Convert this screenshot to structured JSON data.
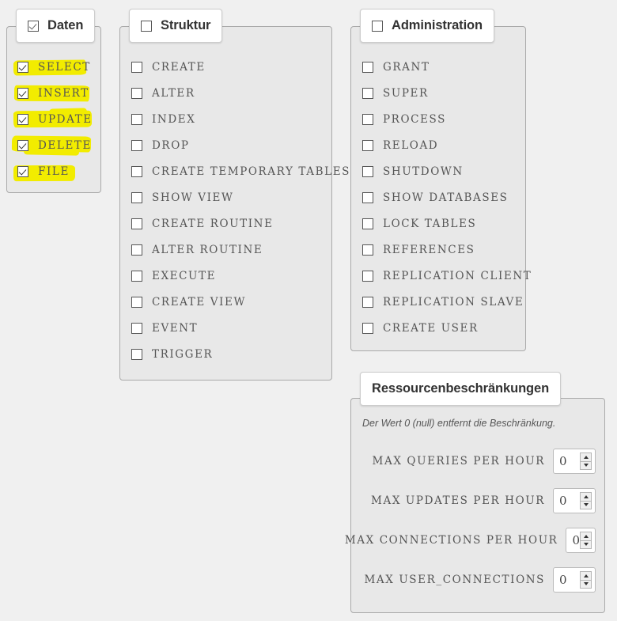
{
  "groups": {
    "daten": {
      "title": "Daten",
      "legend_checked": true,
      "items": [
        {
          "label": "SELECT",
          "checked": true,
          "highlighted": true
        },
        {
          "label": "INSERT",
          "checked": true,
          "highlighted": true
        },
        {
          "label": "UPDATE",
          "checked": true,
          "highlighted": true
        },
        {
          "label": "DELETE",
          "checked": true,
          "highlighted": true
        },
        {
          "label": "FILE",
          "checked": true,
          "highlighted": true
        }
      ]
    },
    "struktur": {
      "title": "Struktur",
      "legend_checked": false,
      "items": [
        {
          "label": "CREATE",
          "checked": false
        },
        {
          "label": "ALTER",
          "checked": false
        },
        {
          "label": "INDEX",
          "checked": false
        },
        {
          "label": "DROP",
          "checked": false
        },
        {
          "label": "CREATE TEMPORARY TABLES",
          "checked": false
        },
        {
          "label": "SHOW VIEW",
          "checked": false
        },
        {
          "label": "CREATE ROUTINE",
          "checked": false
        },
        {
          "label": "ALTER ROUTINE",
          "checked": false
        },
        {
          "label": "EXECUTE",
          "checked": false
        },
        {
          "label": "CREATE VIEW",
          "checked": false
        },
        {
          "label": "EVENT",
          "checked": false
        },
        {
          "label": "TRIGGER",
          "checked": false
        }
      ]
    },
    "administration": {
      "title": "Administration",
      "legend_checked": false,
      "items": [
        {
          "label": "GRANT",
          "checked": false
        },
        {
          "label": "SUPER",
          "checked": false
        },
        {
          "label": "PROCESS",
          "checked": false
        },
        {
          "label": "RELOAD",
          "checked": false
        },
        {
          "label": "SHUTDOWN",
          "checked": false
        },
        {
          "label": "SHOW DATABASES",
          "checked": false
        },
        {
          "label": "LOCK TABLES",
          "checked": false
        },
        {
          "label": "REFERENCES",
          "checked": false
        },
        {
          "label": "REPLICATION CLIENT",
          "checked": false
        },
        {
          "label": "REPLICATION SLAVE",
          "checked": false
        },
        {
          "label": "CREATE USER",
          "checked": false
        }
      ]
    },
    "ressourcen": {
      "title": "Ressourcenbeschränkungen",
      "note": "Der Wert 0 (null) entfernt die Beschränkung.",
      "fields": [
        {
          "label": "MAX QUERIES PER HOUR",
          "value": "0"
        },
        {
          "label": "MAX UPDATES PER HOUR",
          "value": "0"
        },
        {
          "label": "MAX CONNECTIONS PER HOUR",
          "value": "0"
        },
        {
          "label": "MAX USER_CONNECTIONS",
          "value": "0"
        }
      ]
    }
  },
  "colors": {
    "page_background": "#f0f0f0",
    "panel_background": "#e8e8e8",
    "panel_border": "#aaaaaa",
    "legend_background": "#ffffff",
    "highlight": "#f2ec00",
    "label_text": "#555555",
    "title_text": "#333333"
  }
}
